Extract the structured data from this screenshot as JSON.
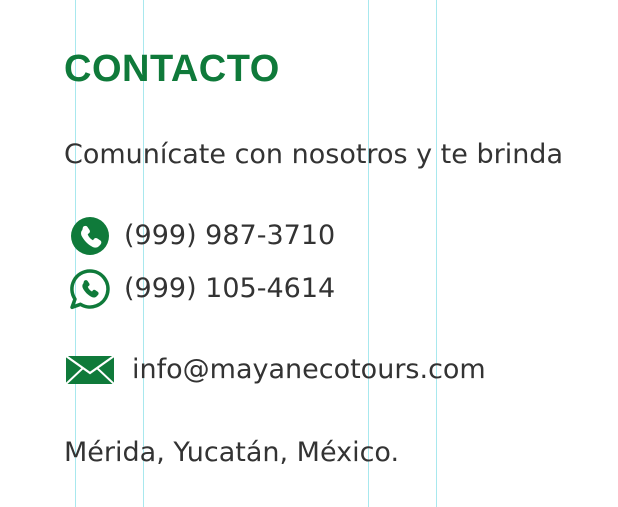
{
  "contact": {
    "title": "CONTACTO",
    "intro": "Comunícate con nosotros y te brinda",
    "phone": "(999) 987-3710",
    "whatsapp": "(999) 105-4614",
    "email": "info@mayanecotours.com",
    "location": "Mérida, Yucatán, México.",
    "icons": {
      "phone": "phone-icon",
      "whatsapp": "whatsapp-icon",
      "email": "envelope-icon"
    },
    "colors": {
      "accent": "#0f7a3a",
      "text": "#333333",
      "guide": "#a8e8ee"
    }
  }
}
